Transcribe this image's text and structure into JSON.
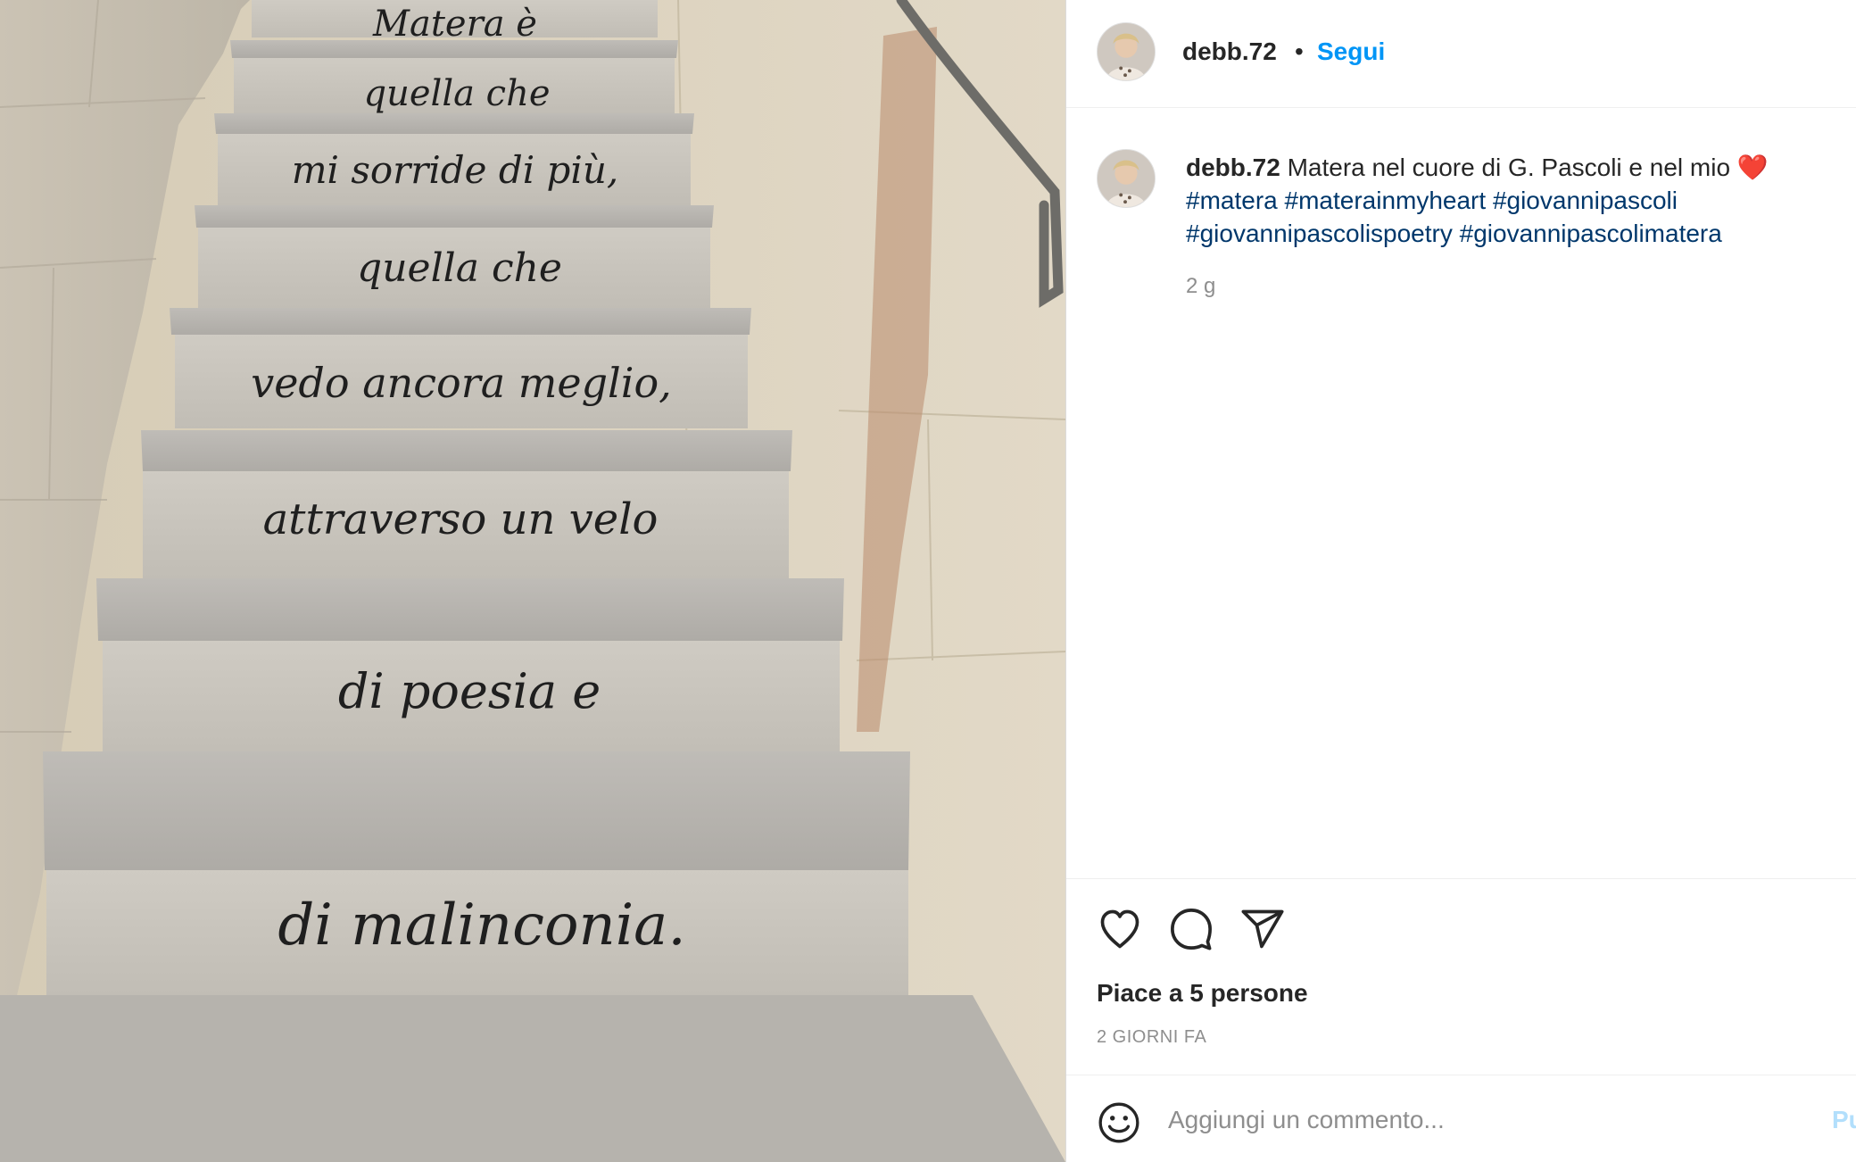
{
  "post": {
    "username": "debb.72",
    "separator": "•",
    "follow_label": "Segui"
  },
  "photo": {
    "poem_lines": [
      "Matera è",
      "quella che",
      "mi sorride di più,",
      "quella che",
      "vedo ancora meglio,",
      "attraverso un velo",
      "di poesia e",
      "di malinconia."
    ]
  },
  "caption": {
    "username": "debb.72",
    "text": "Matera nel cuore di G. Pascoli e nel mio",
    "emoji": "❤️",
    "hashtags": [
      "#matera",
      "#materainmyheart",
      "#giovannipascoli",
      "#giovannipascolispoetry",
      "#giovannipascolimatera"
    ],
    "time_ago": "2 g"
  },
  "actions": {
    "like_icon": "heart-icon",
    "comment_icon": "comment-bubble-icon",
    "share_icon": "paper-plane-icon",
    "likes_text": "Piace a 5 persone",
    "date_text": "2 GIORNI FA"
  },
  "comment": {
    "emoji_icon": "smiley-icon",
    "placeholder": "Aggiungi un commento...",
    "post_label": "Pubblica"
  },
  "colors": {
    "link_blue": "#0095f6",
    "hashtag_blue": "#00376b",
    "muted_text": "#8e8e8e",
    "stone": "#cfc8bb"
  }
}
